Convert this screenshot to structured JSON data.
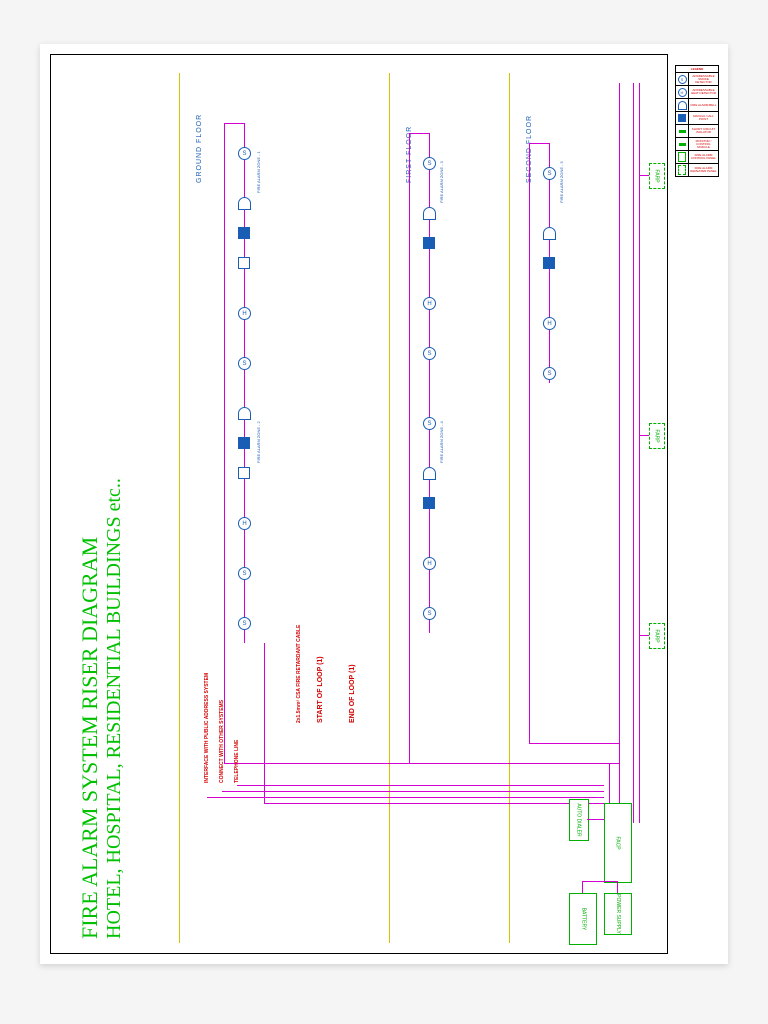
{
  "title_line1": "FIRE ALARM SYSTEM RISER DIAGRAM",
  "title_line2": "HOTEL, HOSPITAL, RESIDENTIAL BUILDINGS etc..",
  "floors": {
    "second": "SECOND FLOOR",
    "first": "FIRST FLOOR",
    "ground": "GROUND FLOOR"
  },
  "loop": {
    "end": "END OF LOOP (1)",
    "start": "START OF LOOP (1)",
    "cable": "2x1.5mm² CSA FIRE RETARDANT CABLE"
  },
  "interfaces": {
    "telephone": "TELEPHONE LINE",
    "other": "CONNECT WITH OTHER SYSTEMS",
    "pa": "INTERFACE WITH PUBLIC ADDRESS SYSTEM"
  },
  "components": {
    "facp": "FACP",
    "auto_dialer": "AUTO DIALER",
    "power": "POWER SUPPLY",
    "battery": "BATTERY",
    "farp": "FARP"
  },
  "zones": {
    "ground_left": "FIRE ALARM ZONE - 1",
    "ground_right": "FIRE ALARM ZONE - 2",
    "first_left": "FIRE ALARM ZONE - 3",
    "first_right": "FIRE ALARM ZONE - 4",
    "second": "FIRE ALARM ZONE - 5"
  },
  "legend": {
    "title": "LEGEND",
    "items": [
      {
        "sym": "S",
        "label": "ADDRESSABLE SMOKE DETECTOR"
      },
      {
        "sym": "H",
        "label": "ADDRESSABLE HEAT DETECTOR"
      },
      {
        "sym": "bell",
        "label": "FIRE ALARM BELL"
      },
      {
        "sym": "sq",
        "label": "MANUAL CALL POINT"
      },
      {
        "sym": "bar",
        "label": "SHORT CIRCUIT ISOLATOR"
      },
      {
        "sym": "bar2",
        "label": "MONITOR / CONTROL MODULE"
      },
      {
        "sym": "facp",
        "label": "FIRE ALARM CONTROL PANEL"
      },
      {
        "sym": "farp",
        "label": "FIRE ALARM REPEATER PANEL"
      }
    ]
  }
}
